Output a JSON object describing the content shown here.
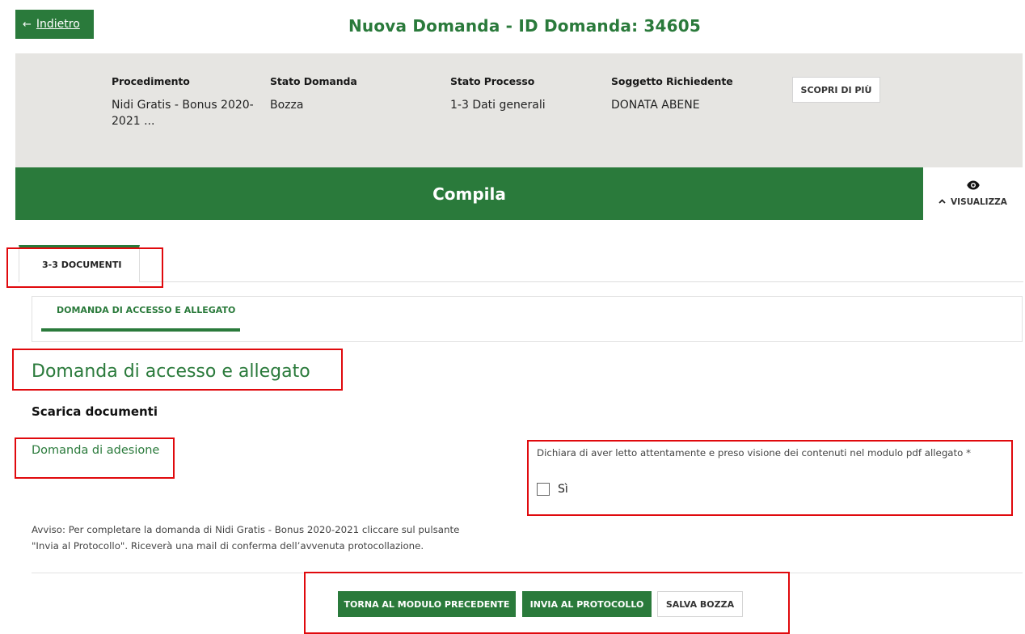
{
  "header": {
    "back_arrow": "←",
    "back_label": "Indietro",
    "title": "Nuova Domanda - ID Domanda: 34605"
  },
  "info": {
    "procedimento": {
      "label": "Procedimento",
      "value_line1": "Nidi Gratis - Bonus 2020-",
      "value_line2": "2021 ..."
    },
    "stato_domanda": {
      "label": "Stato Domanda",
      "value": "Bozza"
    },
    "stato_processo": {
      "label": "Stato Processo",
      "value": "1-3 Dati generali"
    },
    "soggetto": {
      "label": "Soggetto Richiedente",
      "value": "DONATA ABENE"
    },
    "scopri_label": "SCOPRI DI PIÙ"
  },
  "compila": {
    "title": "Compila",
    "visualizza_icon": "eye-icon",
    "visualizza_label": "VISUALIZZA"
  },
  "tabs": {
    "active": "3-3 DOCUMENTI",
    "subtab": "DOMANDA DI ACCESSO E ALLEGATO"
  },
  "section": {
    "title": "Domanda di accesso e allegato",
    "scarica_heading": "Scarica documenti",
    "doc_link": "Domanda di adesione",
    "dichiara": "Dichiara di aver letto attentamente e preso visione dei contenuti nel modulo pdf allegato *",
    "checkbox_label": "Sì",
    "checkbox_checked": false,
    "avviso_line1": "Avviso: Per completare la domanda di Nidi Gratis - Bonus 2020-2021 cliccare sul pulsante",
    "avviso_line2": "\"Invia al Protocollo\". Riceverà una mail di conferma dell’avvenuta protocollazione."
  },
  "actions": {
    "back_label": "TORNA AL MODULO PRECEDENTE",
    "send_label": "INVIA AL PROTOCOLLO",
    "draft_label": "SALVA BOZZA"
  },
  "colors": {
    "brand_green": "#2a7a3b",
    "panel_grey": "#e6e5e2",
    "highlight_red": "#e0090d"
  }
}
